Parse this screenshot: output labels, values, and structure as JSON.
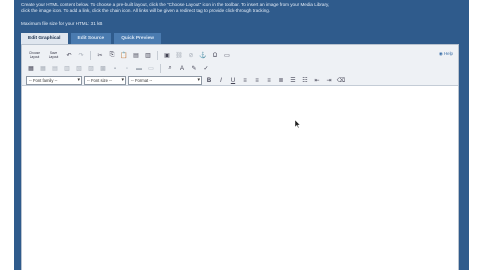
{
  "instructions": {
    "line1": "Create your HTML content below. To choose a pre-built layout, click the \"Choose Layout\" icon in the toolbar. To insert an image from your Media Library,",
    "line2": "click the image icon. To add a link, click the chain icon. All links will be given a redirect tag to provide click-through tracking.",
    "max_size": "Maximum file size for your HTML: 31 kB"
  },
  "tabs": [
    {
      "label": "Edit Graphical",
      "active": true
    },
    {
      "label": "Edit Source",
      "active": false
    },
    {
      "label": "Quick Preview",
      "active": false
    }
  ],
  "toolbar": {
    "choose_layout_top": "Choose",
    "choose_layout_bottom": "Layout",
    "save_layout_top": "Save",
    "save_layout_bottom": "Layout",
    "help_label": "Help",
    "font_family": "-- Font family --",
    "font_size": "-- Font size --",
    "format": "-- Format --"
  },
  "colors": {
    "frame": "#2f5b8c",
    "active_tab": "#dfe6ef",
    "inactive_tab": "#4a7bb0"
  }
}
